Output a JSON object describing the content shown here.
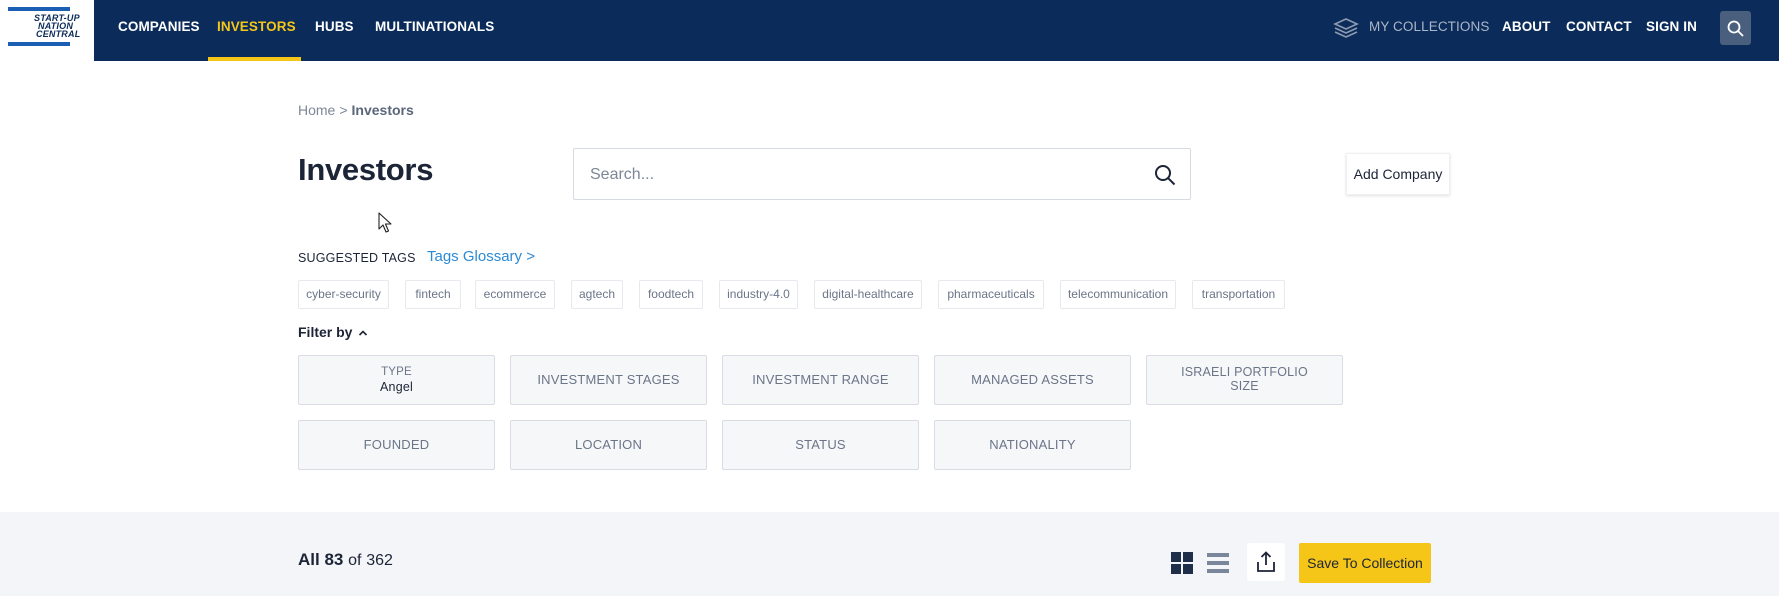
{
  "nav": {
    "logo_lines": [
      "START-UP",
      "NATION",
      "CENTRAL"
    ],
    "items": [
      {
        "label": "COMPANIES"
      },
      {
        "label": "INVESTORS"
      },
      {
        "label": "HUBS"
      },
      {
        "label": "MULTINATIONALS"
      }
    ],
    "active": "INVESTORS",
    "right_items": {
      "collections": "MY COLLECTIONS",
      "about": "ABOUT",
      "contact": "CONTACT",
      "signin": "SIGN IN"
    },
    "icons": {
      "collections": "layers-icon",
      "search": "search-icon"
    },
    "colors": {
      "background": "#0b2c5a",
      "accent": "#f5c518"
    }
  },
  "breadcrumb": {
    "home": "Home",
    "separator": ">",
    "current": "Investors"
  },
  "page": {
    "title": "Investors",
    "search_placeholder": "Search...",
    "add_company": "Add Company"
  },
  "tags": {
    "label": "SUGGESTED TAGS",
    "glossary": "Tags Glossary >",
    "items": [
      "cyber-security",
      "fintech",
      "ecommerce",
      "agtech",
      "foodtech",
      "industry-4.0",
      "digital-healthcare",
      "pharmaceuticals",
      "telecommunication",
      "transportation"
    ]
  },
  "filters": {
    "label": "Filter by",
    "type": {
      "label": "TYPE",
      "value": "Angel"
    },
    "investment_stages": "INVESTMENT STAGES",
    "investment_range": "INVESTMENT RANGE",
    "managed_assets": "MANAGED ASSETS",
    "israeli_portfolio_line1": "ISRAELI PORTFOLIO",
    "israeli_portfolio_line2": "SIZE",
    "founded": "FOUNDED",
    "location": "LOCATION",
    "status": "STATUS",
    "nationality": "NATIONALITY"
  },
  "results": {
    "prefix": "All",
    "count": "83",
    "of_label": "of",
    "total": "362",
    "save_button": "Save To Collection",
    "icons": {
      "grid": "grid-view-icon",
      "list": "list-view-icon",
      "share": "share-icon"
    }
  }
}
